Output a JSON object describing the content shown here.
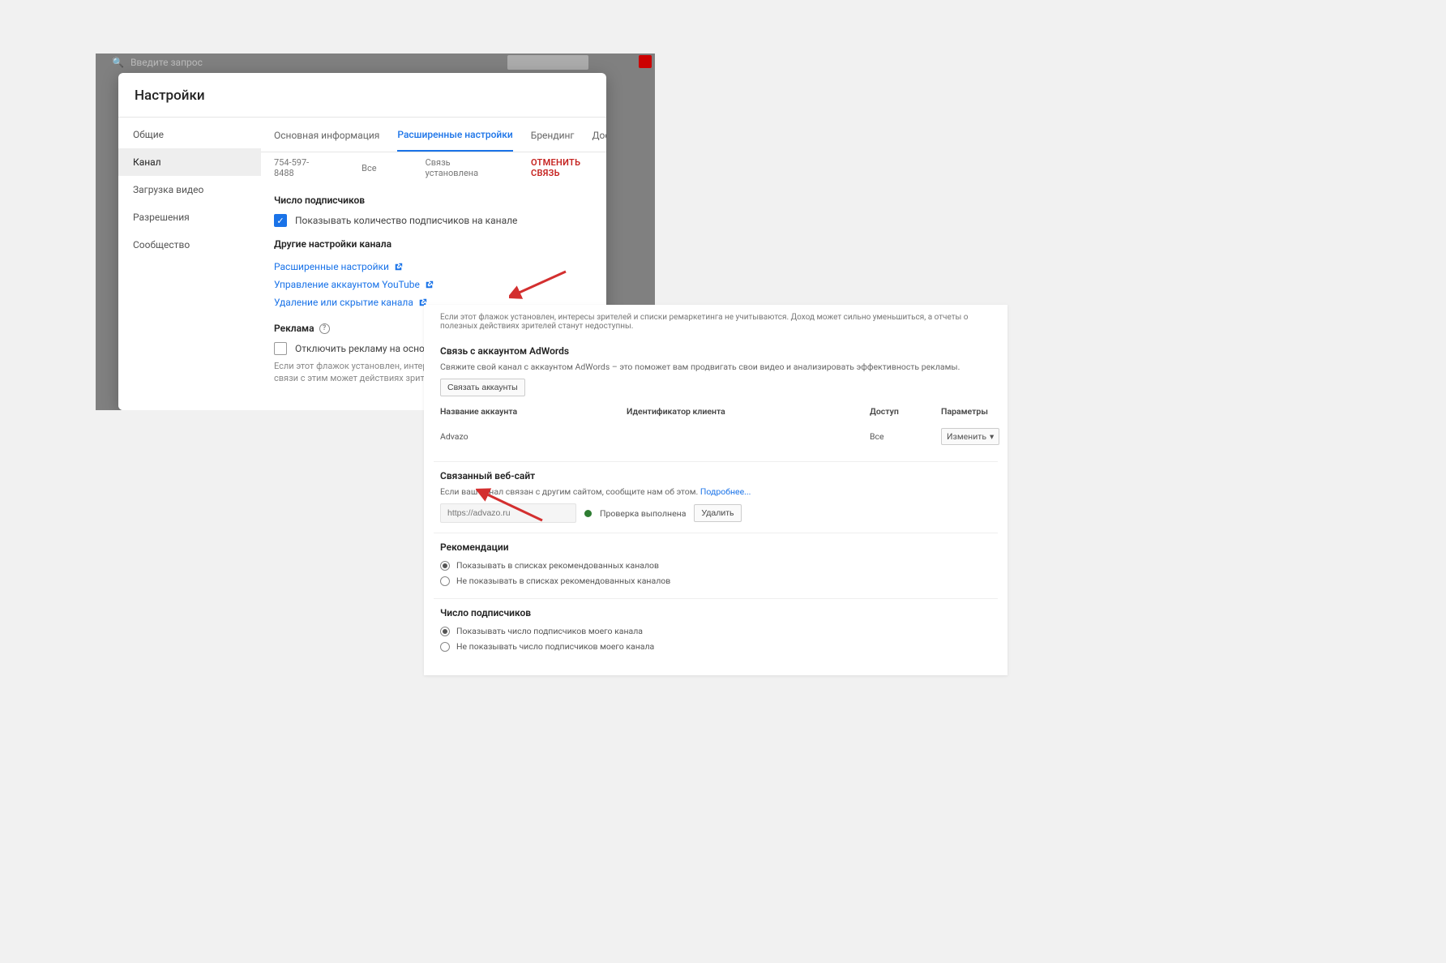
{
  "modal": {
    "title": "Настройки",
    "search_placeholder": "Введите запрос",
    "sidebar": {
      "items": [
        {
          "label": "Общие"
        },
        {
          "label": "Канал",
          "active": true
        },
        {
          "label": "Загрузка видео"
        },
        {
          "label": "Разрешения"
        },
        {
          "label": "Сообщество"
        }
      ]
    },
    "tabs": [
      {
        "label": "Основная информация"
      },
      {
        "label": "Расширенные настройки",
        "active": true
      },
      {
        "label": "Брендинг"
      },
      {
        "label": "Досту"
      }
    ],
    "truncated": {
      "phone": "754-597-8488",
      "access": "Все",
      "status": "Связь установлена",
      "cancel": "ОТМЕНИТЬ СВЯЗЬ"
    },
    "subscribers": {
      "heading": "Число подписчиков",
      "checkbox_label": "Показывать количество подписчиков на канале"
    },
    "other": {
      "heading": "Другие настройки канала",
      "links": [
        "Расширенные настройки",
        "Управление аккаунтом YouTube",
        "Удаление или скрытие канала"
      ]
    },
    "ads": {
      "heading": "Реклама",
      "checkbox_label": "Отключить рекламу на основе ин",
      "note": "Если этот флажок установлен, интересы зрите рекламы в ваших видео. В связи с этим может действиях зрителей станут недоступны."
    }
  },
  "right": {
    "top_note": "Если этот флажок установлен, интересы зрителей и списки ремаркетинга не учитываются. Доход может сильно уменьшиться, а отчеты о полезных действиях зрителей станут недоступны.",
    "adwords": {
      "heading": "Связь с аккаунтом AdWords",
      "sub": "Свяжите свой канал с аккаунтом AdWords – это поможет вам продвигать свои видео и анализировать эффективность рекламы.",
      "link_btn": "Связать аккаунты",
      "cols": {
        "name": "Название аккаунта",
        "id": "Идентификатор клиента",
        "access": "Доступ",
        "params": "Параметры"
      },
      "row": {
        "name": "Advazo",
        "access": "Все",
        "params": "Изменить"
      }
    },
    "site": {
      "heading": "Связанный веб-сайт",
      "sub_prefix": "Если ваш канал связан с другим сайтом, сообщите нам об этом. ",
      "sub_link": "Подробнее...",
      "input_placeholder": "https://advazo.ru",
      "status": "Проверка выполнена",
      "remove": "Удалить"
    },
    "recs": {
      "heading": "Рекомендации",
      "opt1": "Показывать в списках рекомендованных каналов",
      "opt2": "Не показывать в списках рекомендованных каналов"
    },
    "subs": {
      "heading": "Число подписчиков",
      "opt1": "Показывать число подписчиков моего канала",
      "opt2": "Не показывать число подписчиков моего канала"
    }
  }
}
